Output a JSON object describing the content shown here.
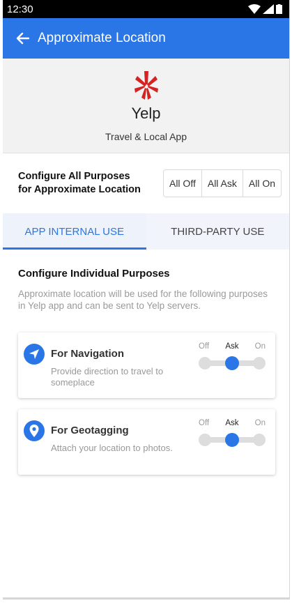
{
  "status": {
    "time": "12:30"
  },
  "appbar": {
    "title": "Approximate Location"
  },
  "app": {
    "name": "Yelp",
    "category": "Travel & Local App"
  },
  "config_all": {
    "label_line1": "Configure All Purposes",
    "label_line2": "for Approximate Location",
    "buttons": [
      "All Off",
      "All Ask",
      "All On"
    ]
  },
  "tabs": [
    {
      "label": "APP INTERNAL USE",
      "active": true
    },
    {
      "label": "THIRD-PARTY USE",
      "active": false
    }
  ],
  "section": {
    "title": "Configure Individual Purposes",
    "description": "Approximate location will be used for the following purposes in Yelp app and can be sent to Yelp servers."
  },
  "purposes": [
    {
      "title": "For Navigation",
      "description": "Provide direction to travel to someplace",
      "icon": "navigation-arrow-icon",
      "state": "Ask"
    },
    {
      "title": "For Geotagging",
      "description": "Attach your location to photos.",
      "icon": "location-pin-icon",
      "state": "Ask"
    }
  ],
  "toggle_labels": {
    "off": "Off",
    "ask": "Ask",
    "on": "On"
  },
  "colors": {
    "accent": "#2a76e6",
    "yelp_red": "#d32323"
  }
}
